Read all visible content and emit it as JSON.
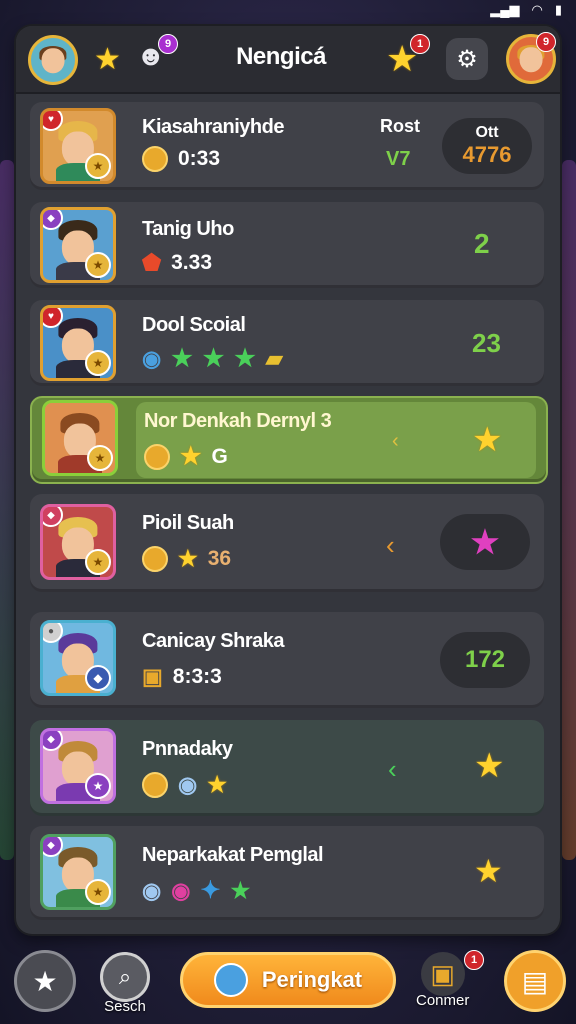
{
  "header": {
    "title": "Nengicá",
    "badge_count_star": "1",
    "badge_count_profile": "9",
    "badge_count_mask": "9"
  },
  "rows": [
    {
      "name": "Kiasahraniyhde",
      "value": "0:33",
      "col_label_1": "Rost",
      "col_value_1": "V7",
      "col_label_2": "Ott",
      "col_value_2": "4776"
    },
    {
      "name": "Tanig Uho",
      "value": "3.33",
      "side_value": "2"
    },
    {
      "name": "Dool Scoial",
      "side_value": "23"
    },
    {
      "name": "Nor Denkah Dernyl 3",
      "value": "G"
    },
    {
      "name": "Pioil Suah",
      "value": "36"
    },
    {
      "name": "Canicay Shraka",
      "value": "8:3:3",
      "side_value": "172"
    },
    {
      "name": "Pnnadaky"
    },
    {
      "name": "Neparkakat Pemglal"
    }
  ],
  "nav": {
    "search_label": "Sesch",
    "cta_label": "Peringkat",
    "corner_label": "Conmer",
    "corner_badge": "1"
  },
  "colors": {
    "panel": "#34363d",
    "row": "#404148",
    "highlight_row": "#64873a",
    "accent_orange": "#f08a1c",
    "accent_green": "#7ed04a",
    "star": "#ffd22e"
  }
}
